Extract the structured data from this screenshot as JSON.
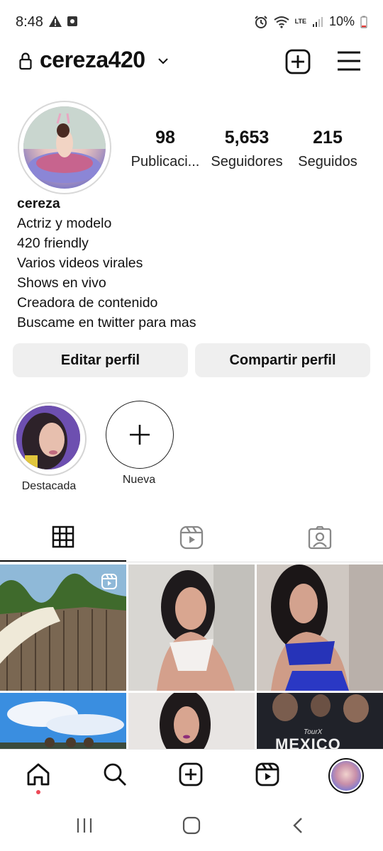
{
  "status_bar": {
    "time": "8:48",
    "battery": "10%",
    "network": "LTE"
  },
  "header": {
    "username": "cereza420"
  },
  "profile": {
    "stats": [
      {
        "value": "98",
        "label": "Publicaci..."
      },
      {
        "value": "5,653",
        "label": "Seguidores"
      },
      {
        "value": "215",
        "label": "Seguidos"
      }
    ],
    "name": "cereza",
    "bio_lines": [
      "Actriz y modelo",
      "420 friendly",
      "Varios videos virales",
      "Shows en vivo",
      "Creadora de contenido",
      "Buscame en twitter para mas"
    ],
    "buttons": {
      "edit": "Editar perfil",
      "share": "Compartir perfil"
    }
  },
  "highlights": [
    {
      "label": "Destacada"
    },
    {
      "label": "Nueva"
    }
  ],
  "tabs": [
    "grid-icon",
    "reels-icon",
    "tagged-icon"
  ],
  "grid_posts": [
    {
      "media": "photo",
      "badge": "reel"
    },
    {
      "media": "photo"
    },
    {
      "media": "photo"
    },
    {
      "media": "photo"
    },
    {
      "media": "photo"
    },
    {
      "media": "photo",
      "overlay_text": "TourX",
      "overlay_text2": "MEXICO"
    }
  ],
  "bottom_nav": [
    "home-icon",
    "search-icon",
    "create-icon",
    "reels-icon",
    "profile-avatar"
  ],
  "colors": {
    "accent": "#ed4956",
    "tab_active": "#111111",
    "button_bg": "#efefef"
  }
}
